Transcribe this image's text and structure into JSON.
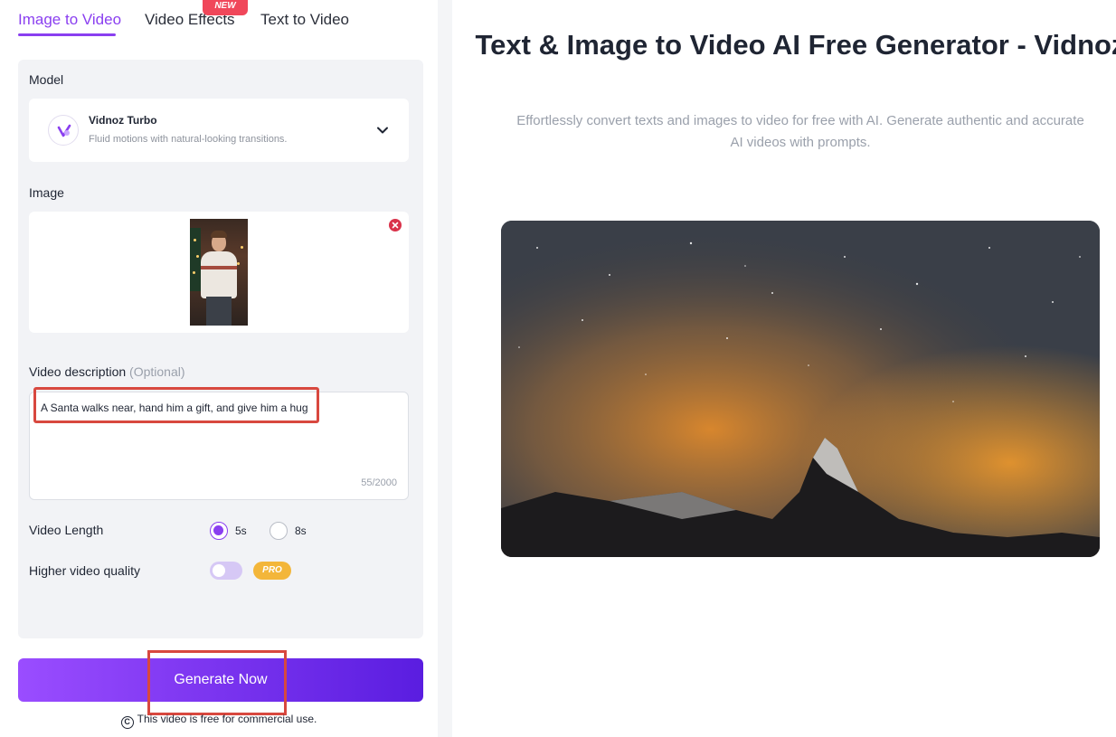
{
  "tabs": [
    {
      "label": "Image to Video",
      "active": true
    },
    {
      "label": "Video Effects",
      "badge": "NEW"
    },
    {
      "label": "Text to Video"
    }
  ],
  "form": {
    "model_label": "Model",
    "model_name": "Vidnoz Turbo",
    "model_desc": "Fluid motions with natural-looking transitions.",
    "image_label": "Image",
    "desc_label": "Video description",
    "desc_optional": "(Optional)",
    "desc_value": "A Santa walks near, hand him a gift, and give him a hug",
    "char_count": "55/2000",
    "length_label": "Video Length",
    "length_options": [
      "5s",
      "8s"
    ],
    "length_selected": "5s",
    "quality_label": "Higher video quality",
    "quality_badge": "PRO",
    "quality_enabled": false,
    "generate_label": "Generate Now",
    "free_note": "This video is free for commercial use."
  },
  "main": {
    "title": "Text & Image to Video AI Free Generator - Vidnoz",
    "subtitle": "Effortlessly convert texts and images to video for free with AI. Generate authentic and accurate AI videos with prompts."
  },
  "colors": {
    "accent": "#8a3ff0",
    "badge_new": "#f0475a",
    "badge_pro": "#f3b63a",
    "highlight": "#d8483f"
  }
}
